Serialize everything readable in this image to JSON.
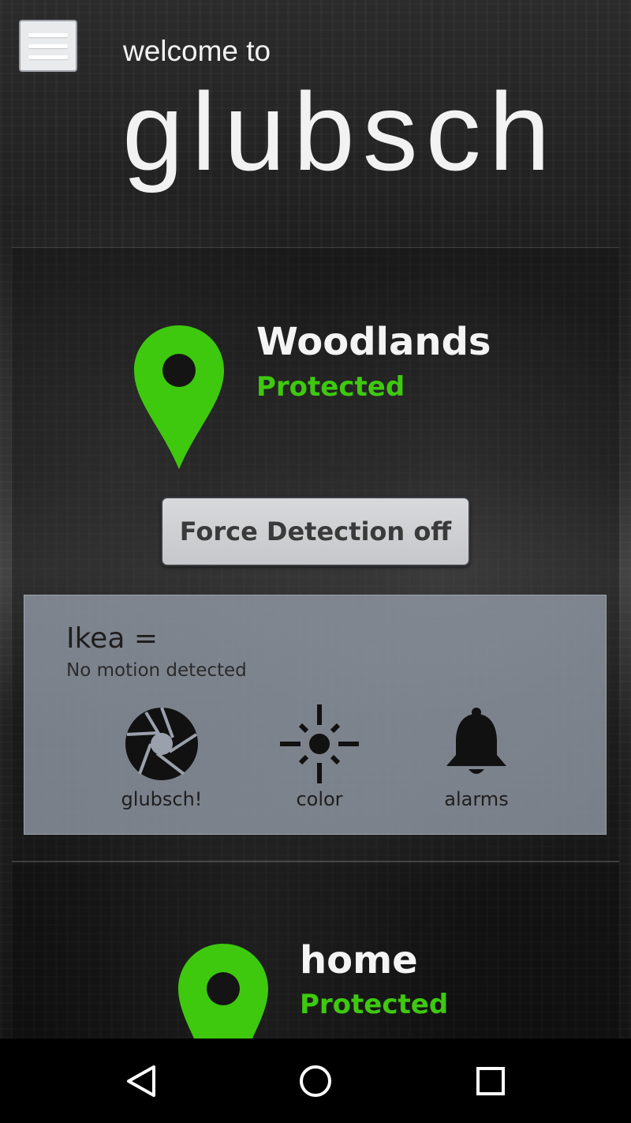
{
  "header": {
    "welcome": "welcome to",
    "brand": "glubsch"
  },
  "locations": [
    {
      "name": "Woodlands",
      "status": "Protected",
      "force_button_label": "Force Detection off",
      "device": {
        "name": "Ikea =",
        "status": "No motion detected",
        "actions": [
          {
            "label": "glubsch!",
            "icon": "camera-shutter-icon"
          },
          {
            "label": "color",
            "icon": "brightness-icon"
          },
          {
            "label": "alarms",
            "icon": "bell-icon"
          }
        ]
      }
    },
    {
      "name": "home",
      "status": "Protected"
    }
  ],
  "colors": {
    "accent_green": "#3ec90e",
    "panel": "#969eaa",
    "button": "#d0d1d3"
  },
  "navbar": {
    "icons": [
      "back-icon",
      "home-icon",
      "recents-icon"
    ]
  }
}
